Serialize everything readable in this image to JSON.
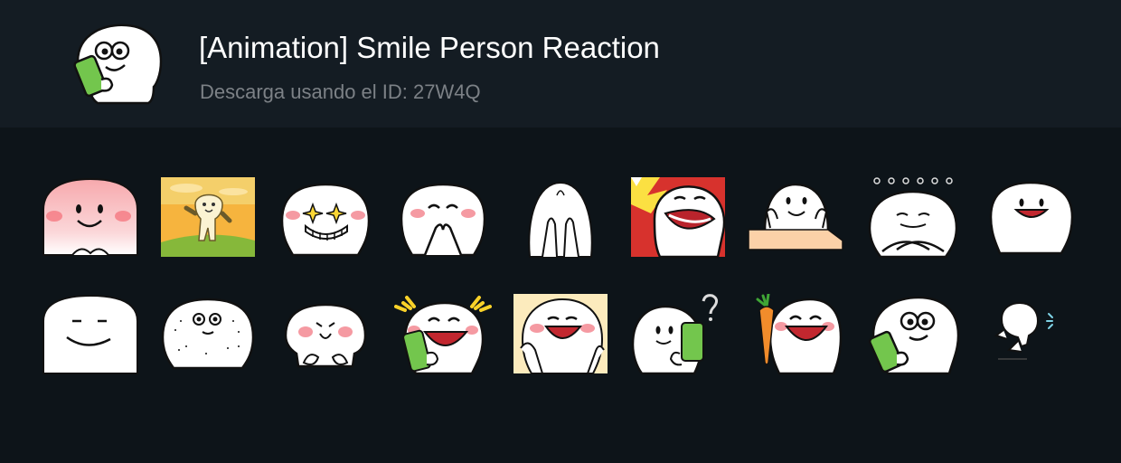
{
  "pack": {
    "title": "[Animation] Smile Person Reaction",
    "subtitle": "Descarga usando el ID: 27W4Q",
    "icon": "smile-person-phone-icon"
  },
  "stickers": [
    {
      "name": "blushing-pink-face-sticker"
    },
    {
      "name": "dancing-in-field-sticker"
    },
    {
      "name": "sparkle-eyes-grin-sticker"
    },
    {
      "name": "hands-over-mouth-sticker"
    },
    {
      "name": "hands-covering-face-sticker"
    },
    {
      "name": "laughing-burst-red-sticker"
    },
    {
      "name": "peeking-over-wall-sticker"
    },
    {
      "name": "arms-crossed-dots-sticker"
    },
    {
      "name": "happy-open-mouth-sticker"
    },
    {
      "name": "smirk-face-sticker"
    },
    {
      "name": "wide-eyed-dots-sticker"
    },
    {
      "name": "shy-small-sticker"
    },
    {
      "name": "laughing-at-phone-sticker"
    },
    {
      "name": "laughing-yellow-bg-sticker"
    },
    {
      "name": "phone-question-mark-sticker"
    },
    {
      "name": "holding-carrot-sticker"
    },
    {
      "name": "staring-at-phone-sticker"
    },
    {
      "name": "running-away-sticker"
    }
  ]
}
